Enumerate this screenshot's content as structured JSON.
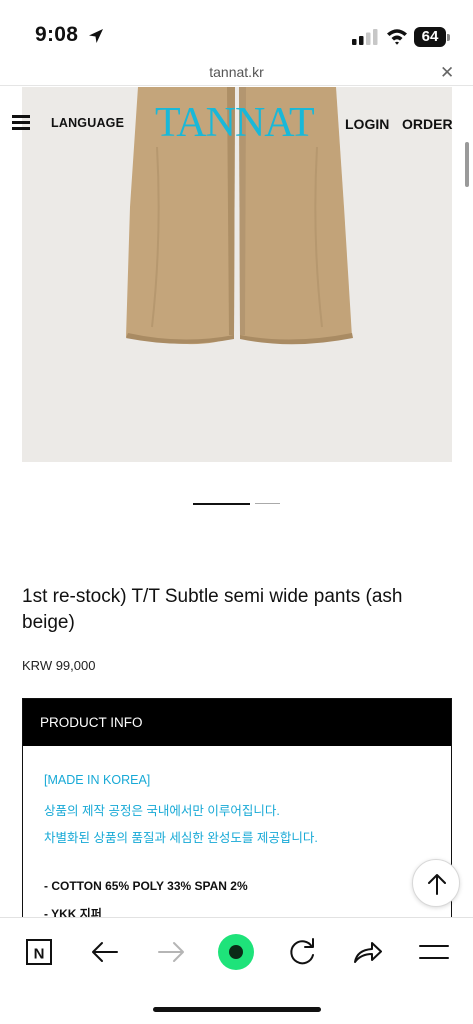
{
  "status_bar": {
    "time": "9:08",
    "battery": "64",
    "icons": [
      "location-arrow-icon",
      "signal-icon",
      "wifi-icon",
      "battery-icon"
    ]
  },
  "browser": {
    "url": "tannat.kr",
    "close_icon": "close-icon",
    "close_glyph": "✕"
  },
  "header": {
    "menu_icon": "hamburger-menu-icon",
    "language": "LANGUAGE",
    "logo": "TANNAT",
    "login": "LOGIN",
    "order": "ORDER"
  },
  "carousel": {
    "slide_count": 2,
    "active_index": 0
  },
  "product": {
    "title": "1st re-stock) T/T Subtle semi wide pants (ash beige)",
    "price": "KRW 99,000"
  },
  "product_info": {
    "heading": "PRODUCT INFO",
    "made_in": "[MADE IN KOREA]",
    "line1": "상품의 제작 공정은 국내에서만 이루어집니다.",
    "line2": "차별화된 상품의 품질과 세심한 완성도를 제공합니다.",
    "composition": "- COTTON 65% POLY 33% SPAN 2%",
    "zipper": "- YKK 지퍼"
  },
  "toolbar": {
    "items": [
      "naver-n-icon",
      "back-arrow-icon",
      "forward-arrow-icon",
      "green-dot-icon",
      "reload-icon",
      "share-icon",
      "menu-icon"
    ],
    "naver_letter": "N"
  },
  "colors": {
    "logo": "#19b8d8",
    "info_text": "#17a9d6",
    "green": "#1ee37a",
    "pants": "#c4a57b"
  }
}
